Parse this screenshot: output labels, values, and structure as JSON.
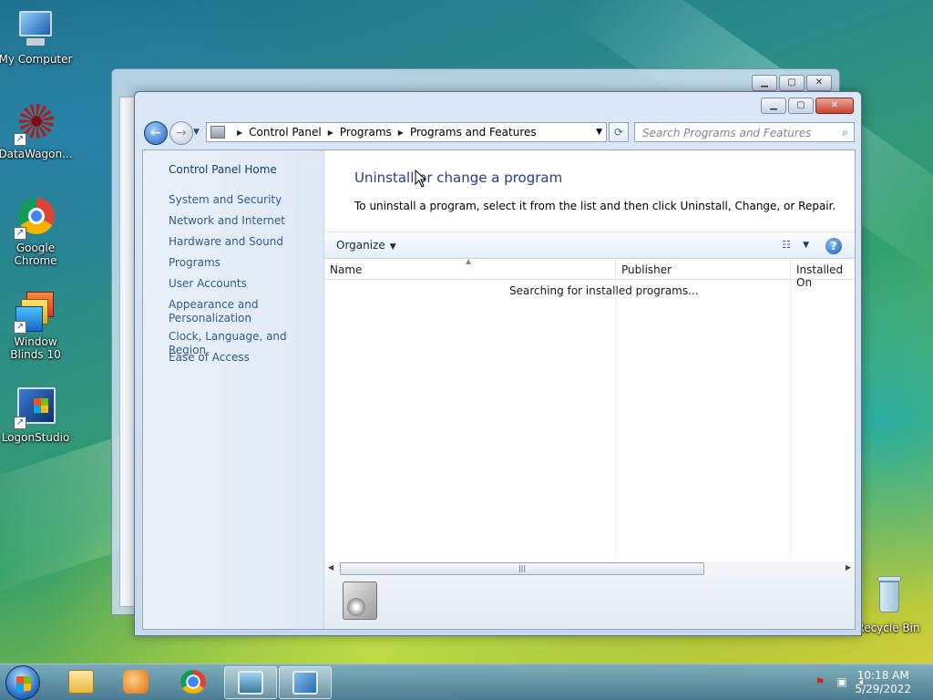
{
  "desktop": {
    "icons": [
      {
        "label": "My Computer",
        "icon": "computer-icon"
      },
      {
        "label": "DataWagon...",
        "icon": "datawagon-icon"
      },
      {
        "label": "Google Chrome",
        "icon": "chrome-icon"
      },
      {
        "label": "Window Blinds 10",
        "icon": "windowblinds-icon"
      },
      {
        "label": "LogonStudio",
        "icon": "logonstudio-icon"
      },
      {
        "label": "Recycle Bin",
        "icon": "recycle-bin-icon"
      }
    ]
  },
  "window": {
    "address": {
      "crumbs": [
        "Control Panel",
        "Programs",
        "Programs and Features"
      ]
    },
    "search_placeholder": "Search Programs and Features",
    "left_pane": {
      "home": "Control Panel Home",
      "items": [
        "System and Security",
        "Network and Internet",
        "Hardware and Sound",
        "Programs",
        "User Accounts",
        "Appearance and Personalization",
        "Clock, Language, and Region",
        "Ease of Access"
      ]
    },
    "main": {
      "title": "Uninstall or change a program",
      "description": "To uninstall a program, select it from the list and then click Uninstall, Change, or Repair.",
      "organize": "Organize",
      "columns": [
        "Name",
        "Publisher",
        "Installed On"
      ],
      "status": "Searching for installed programs..."
    }
  },
  "taskbar": {
    "time": "10:18 AM",
    "date": "5/29/2022"
  },
  "colors": {
    "link": "#335e8a",
    "title": "#1e3f8a",
    "close_button": "#c8422e"
  }
}
